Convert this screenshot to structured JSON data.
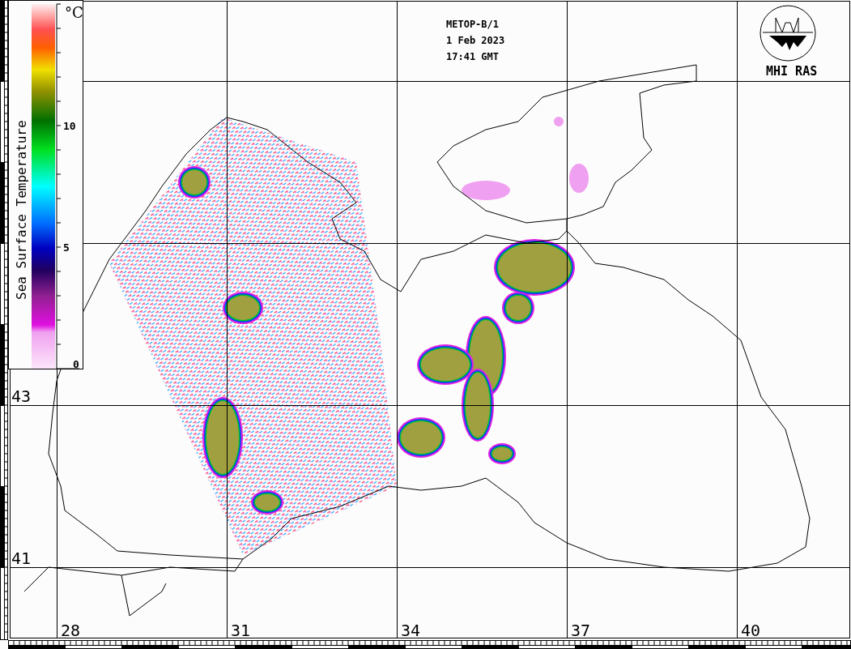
{
  "pass": {
    "satellite": "METOP-B/1",
    "date": "1 Feb 2023",
    "time": "17:41 GMT"
  },
  "logo": {
    "label": "MHI RAS"
  },
  "colorbar": {
    "title": "Sea Surface Temperature",
    "unit": "°C",
    "ticks": [
      "0",
      "5",
      "10"
    ]
  },
  "latitude_labels": [
    "43",
    "41"
  ],
  "longitude_labels": [
    "28",
    "31",
    "34",
    "37",
    "40"
  ]
}
